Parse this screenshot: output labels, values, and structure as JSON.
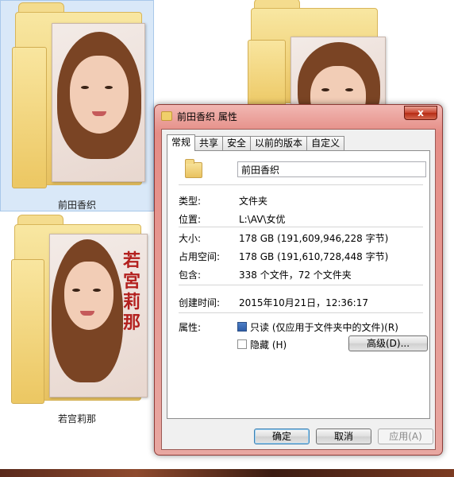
{
  "explorer": {
    "folders": [
      {
        "label": "前田香织",
        "selected": true
      },
      {
        "label": "",
        "selected": false
      },
      {
        "label": "若宫莉那",
        "selected": false
      }
    ],
    "cover_text": "若宮莉那"
  },
  "dialog": {
    "title": "前田香织 属性",
    "close_glyph": "x",
    "tabs": [
      "常规",
      "共享",
      "安全",
      "以前的版本",
      "自定义"
    ],
    "active_tab": "常规",
    "folder_name": "前田香织",
    "rows": {
      "type": {
        "label": "类型:",
        "value": "文件夹"
      },
      "location": {
        "label": "位置:",
        "value": "L:\\AV\\女优"
      },
      "size": {
        "label": "大小:",
        "value": "178 GB (191,609,946,228 字节)"
      },
      "size_on_disk": {
        "label": "占用空间:",
        "value": "178 GB (191,610,728,448 字节)"
      },
      "contains": {
        "label": "包含:",
        "value": "338 个文件，72 个文件夹"
      },
      "created": {
        "label": "创建时间:",
        "value": "2015年10月21日，12:36:17"
      }
    },
    "attributes": {
      "label": "属性:",
      "readonly": {
        "label": "只读 (仅应用于文件夹中的文件)(R)",
        "checked": "indeterminate"
      },
      "hidden": {
        "label": "隐藏 (H)",
        "checked": false
      },
      "advanced_button": "高级(D)..."
    },
    "buttons": {
      "ok": "确定",
      "cancel": "取消",
      "apply": "应用(A)"
    }
  },
  "colors": {
    "title_bar": "#e58d86",
    "close_button": "#c9452f",
    "selection": "#d9e8f8",
    "folder": "#f1d27a"
  }
}
